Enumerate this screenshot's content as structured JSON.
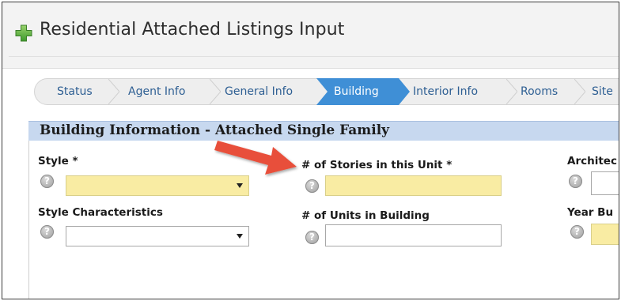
{
  "header": {
    "title": "Residential Attached Listings Input"
  },
  "steps": [
    {
      "label": "Status",
      "active": false
    },
    {
      "label": "Agent Info",
      "active": false
    },
    {
      "label": "General Info",
      "active": false
    },
    {
      "label": "Building",
      "active": true
    },
    {
      "label": "Interior Info",
      "active": false
    },
    {
      "label": "Rooms",
      "active": false
    },
    {
      "label": "Site",
      "active": false
    }
  ],
  "section": {
    "title": "Building Information - Attached Single Family"
  },
  "fields": {
    "style": {
      "label": "Style *",
      "value": "",
      "required": true
    },
    "style_characteristics": {
      "label": "Style Characteristics",
      "value": ""
    },
    "stories_in_unit": {
      "label": "# of Stories in this Unit *",
      "value": "",
      "required": true
    },
    "units_in_building": {
      "label": "# of Units in Building",
      "value": ""
    },
    "architecture": {
      "label": "Architec",
      "value": ""
    },
    "year_built": {
      "label": "Year Bu",
      "value": ""
    }
  },
  "help_glyph": "?",
  "colors": {
    "required_field": "#f9eca3",
    "section_bar": "#c7d8ef",
    "active_step": "#3f8fd6",
    "step_text": "#2e5f93",
    "annotation_arrow": "#e8503a",
    "plus_icon": "#5fb24a"
  },
  "icons": {
    "plus": "plus-icon",
    "help": "help-icon",
    "arrow": "annotation-arrow",
    "dropdown": "chevron-down-icon"
  }
}
